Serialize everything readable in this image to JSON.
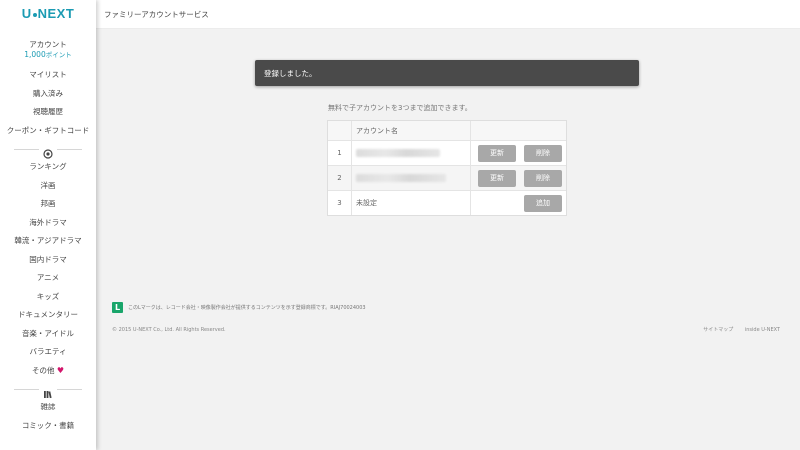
{
  "brand": {
    "logo_left": "U",
    "logo_right": "NEXT"
  },
  "header": {
    "title": "ファミリーアカウントサービス"
  },
  "sidebar": {
    "account_label": "アカウント",
    "points_value": "1,000",
    "points_unit": "ポイント",
    "account_items": [
      "マイリスト",
      "購入済み",
      "視聴履歴",
      "クーポン・ギフトコード"
    ],
    "video_items": [
      "ランキング",
      "洋画",
      "邦画",
      "海外ドラマ",
      "韓流・アジアドラマ",
      "国内ドラマ",
      "アニメ",
      "キッズ",
      "ドキュメンタリー",
      "音楽・アイドル",
      "バラエティ"
    ],
    "other_label": "その他",
    "book_items": [
      "雑誌",
      "コミック・書籍"
    ]
  },
  "toast": {
    "message": "登録しました。"
  },
  "info": {
    "text": "無料で子アカウントを3つまで追加できます。"
  },
  "table": {
    "header_name": "アカウント名",
    "rows": [
      {
        "num": "1",
        "name": "",
        "update": "更新",
        "delete": "削除"
      },
      {
        "num": "2",
        "name": "",
        "update": "更新",
        "delete": "削除"
      },
      {
        "num": "3",
        "name": "未設定",
        "add": "追加"
      }
    ]
  },
  "footer": {
    "notice": "このLマークは、レコード会社・映像製作会社が提供するコンテンツを示す登録商標です。RIAJ70024003",
    "copyright": "© 2015 U-NEXT Co., Ltd. All Rights Reserved.",
    "links": [
      "サイトマップ",
      "inside U-NEXT"
    ]
  },
  "colors": {
    "accent": "#1b9bb3",
    "toast_bg": "#4a4a4a",
    "button": "#a8a8a8",
    "heart": "#d2156b",
    "lmark": "#19a56a"
  }
}
